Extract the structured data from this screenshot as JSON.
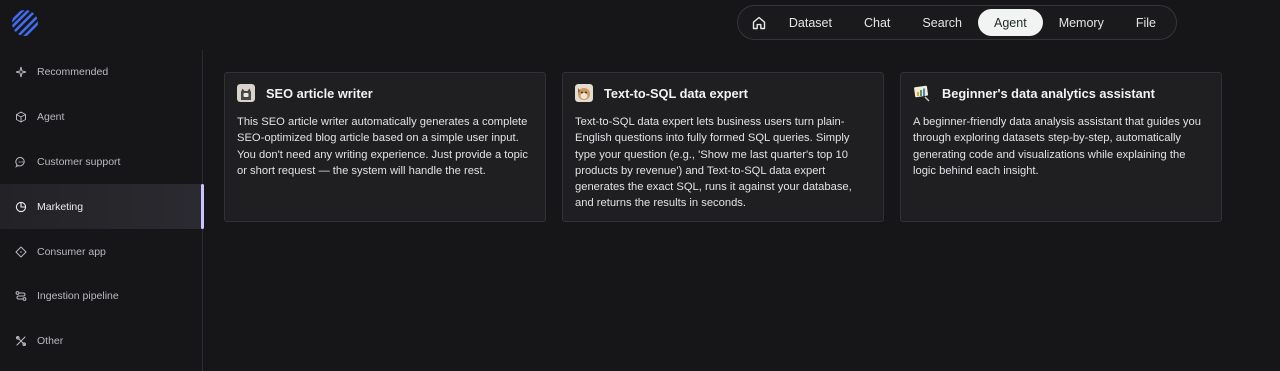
{
  "app": {
    "logo_icon": "diagonal-stripes-logo-icon",
    "accent": "#3f6cf0"
  },
  "topnav": {
    "home_icon": "home-icon",
    "items": [
      {
        "label": "Dataset",
        "active": false
      },
      {
        "label": "Chat",
        "active": false
      },
      {
        "label": "Search",
        "active": false
      },
      {
        "label": "Agent",
        "active": true
      },
      {
        "label": "Memory",
        "active": false
      },
      {
        "label": "File",
        "active": false
      }
    ]
  },
  "sidebar": {
    "items": [
      {
        "label": "Recommended",
        "icon": "sparkle-icon",
        "active": false
      },
      {
        "label": "Agent",
        "icon": "cube-icon",
        "active": false
      },
      {
        "label": "Customer support",
        "icon": "chat-bubble-icon",
        "active": false
      },
      {
        "label": "Marketing",
        "icon": "pie-chart-icon",
        "active": true
      },
      {
        "label": "Consumer app",
        "icon": "dice-icon",
        "active": false
      },
      {
        "label": "Ingestion pipeline",
        "icon": "pipeline-icon",
        "active": false
      },
      {
        "label": "Other",
        "icon": "tools-icon",
        "active": false
      }
    ],
    "active_indicator_color": "#c9c4ff"
  },
  "cards": [
    {
      "title": "SEO article writer",
      "avatar_icon": "cat-avatar-icon",
      "description": "This SEO article writer automatically generates a complete SEO-optimized blog article based on a simple user input. You don't need any writing experience. Just provide a topic or short request — the system will handle the rest."
    },
    {
      "title": "Text-to-SQL data expert",
      "avatar_icon": "dog-avatar-icon",
      "description": "Text-to-SQL data expert lets business users turn plain-English questions into fully formed SQL queries. Simply type your question (e.g., 'Show me last quarter's top 10 products by revenue') and Text-to-SQL data expert generates the exact SQL, runs it against your database, and returns the results in seconds."
    },
    {
      "title": "Beginner's data analytics assistant",
      "avatar_icon": "chart-avatar-icon",
      "description": "A beginner-friendly data analysis assistant that guides you through exploring datasets step-by-step, automatically generating code and visualizations while explaining the logic behind each insight."
    }
  ]
}
